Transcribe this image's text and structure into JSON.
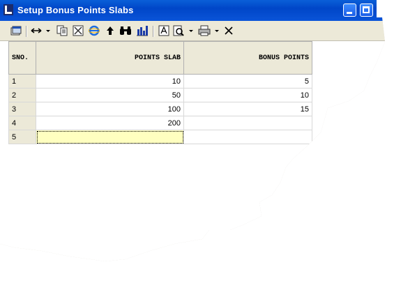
{
  "window": {
    "title": "Setup Bonus Points Slabs"
  },
  "toolbar": {
    "icons": [
      "window-icon",
      "column-width-icon",
      "copy-icon",
      "spreadsheet-icon",
      "internet-explorer-icon",
      "up-arrow-icon",
      "binoculars-icon",
      "bar-chart-icon",
      "font-icon",
      "print-preview-icon",
      "printer-icon",
      "close-x-icon"
    ]
  },
  "grid": {
    "columns": [
      "SNO.",
      "POINTS SLAB",
      "BONUS POINTS"
    ],
    "rows": [
      {
        "sno": "1",
        "points_slab": "10",
        "bonus_points": "5"
      },
      {
        "sno": "2",
        "points_slab": "50",
        "bonus_points": "10"
      },
      {
        "sno": "3",
        "points_slab": "100",
        "bonus_points": "15"
      },
      {
        "sno": "4",
        "points_slab": "200",
        "bonus_points": ""
      },
      {
        "sno": "5",
        "points_slab": "",
        "bonus_points": ""
      }
    ]
  },
  "colors": {
    "titlebar": "#0a54d8",
    "active_cell": "#ffffc0",
    "header_bg": "#ece9d8"
  }
}
